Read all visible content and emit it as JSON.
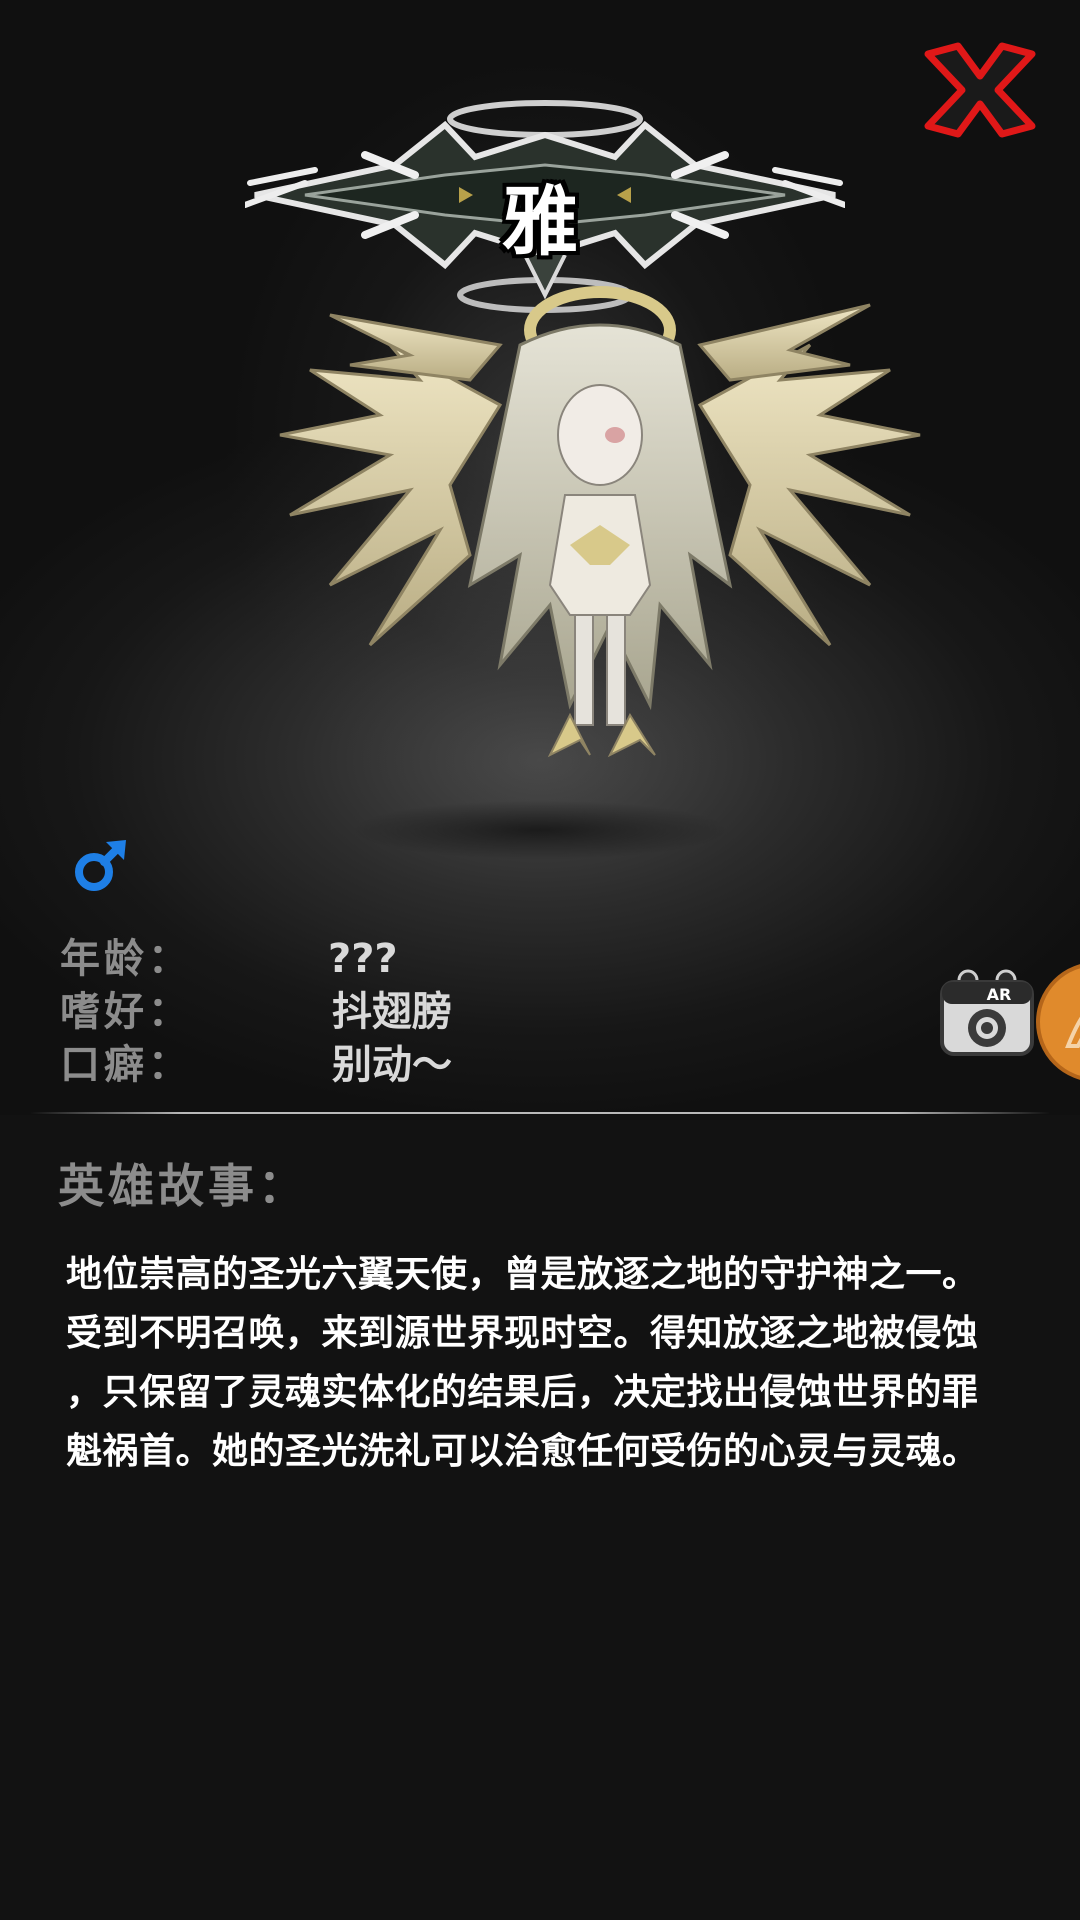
{
  "hero": {
    "name": "雅",
    "gender_icon": "male-symbol-icon",
    "gender_color": "#1e7fe6"
  },
  "info": [
    {
      "label": "年龄：",
      "value": "???"
    },
    {
      "label": "嗜好：",
      "value": "抖翅膀"
    },
    {
      "label": "口癖：",
      "value": "别动～"
    }
  ],
  "story": {
    "heading": "英雄故事：",
    "lines": [
      "地位崇高的圣光六翼天使，曾是放逐之地的守护神之一。",
      "受到不明召唤，来到源世界现时空。得知放逐之地被侵蚀",
      "，只保留了灵魂实体化的结果后，决定找出侵蚀世界的罪",
      "魁祸首。她的圣光洗礼可以治愈任何受伤的心灵与灵魂。"
    ]
  },
  "controls": {
    "close_icon": "close-x-icon",
    "ar_label": "AR",
    "ar_icon": "ar-camera-icon",
    "side_tab_icon": "side-tab-icon"
  },
  "colors": {
    "close_red": "#e01818",
    "label_gray": "#8c8c8c",
    "value_white": "#d9d9d9",
    "side_tab_orange": "#e08a2c"
  }
}
